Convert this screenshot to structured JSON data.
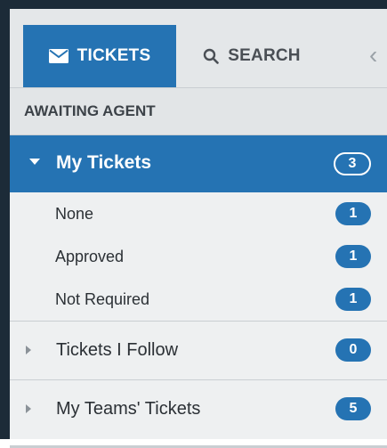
{
  "tabs": {
    "tickets_label": "TICKETS",
    "search_label": "SEARCH",
    "tickets_icon": "envelope-icon",
    "search_icon": "magnifier-icon",
    "collapse_glyph": "‹"
  },
  "section": {
    "header": "AWAITING AGENT"
  },
  "my_tickets": {
    "label": "My Tickets",
    "count": "3",
    "expanded": true,
    "items": [
      {
        "label": "None",
        "count": "1"
      },
      {
        "label": "Approved",
        "count": "1"
      },
      {
        "label": "Not Required",
        "count": "1"
      }
    ]
  },
  "groups": [
    {
      "label": "Tickets I Follow",
      "count": "0"
    },
    {
      "label": "My Teams' Tickets",
      "count": "5"
    }
  ],
  "colors": {
    "accent": "#2573b3",
    "dark": "#1c2b38",
    "panel": "#eef0f1"
  }
}
